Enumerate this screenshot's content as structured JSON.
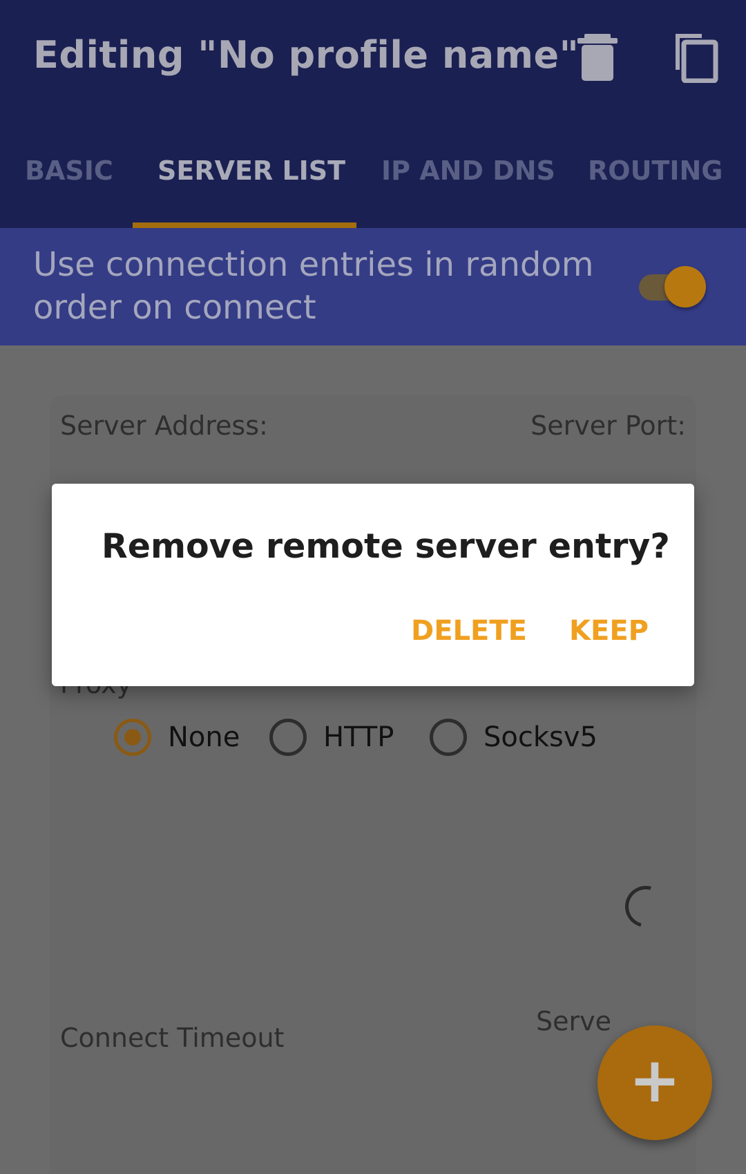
{
  "appbar": {
    "title": "Editing \"No profile name\"",
    "delete_icon": "trash-icon",
    "copy_icon": "copy-icon"
  },
  "tabs": [
    {
      "label": "BASIC",
      "active": false
    },
    {
      "label": "SERVER LIST",
      "active": true
    },
    {
      "label": "IP AND DNS",
      "active": false
    },
    {
      "label": "ROUTING",
      "active": false
    }
  ],
  "random_order": {
    "label": "Use connection entries in random order on connect",
    "enabled": true
  },
  "server_card": {
    "server_address_label": "Server Address:",
    "server_port_label": "Server Port:",
    "proxy_label": "Proxy",
    "proxy_options": [
      {
        "label": "None",
        "selected": true
      },
      {
        "label": "HTTP",
        "selected": false
      },
      {
        "label": "Socksv5",
        "selected": false
      }
    ],
    "connect_timeout_label": "Connect Timeout",
    "server_partial_label": "Serve"
  },
  "dialog": {
    "title": "Remove remote server entry?",
    "delete_label": "DELETE",
    "keep_label": "KEEP"
  },
  "fab": {
    "icon": "plus-icon",
    "symbol": "+"
  },
  "colors": {
    "appbar": "#1b2052",
    "accent": "#f0a020",
    "scrim_background": "#6b6b6b"
  }
}
